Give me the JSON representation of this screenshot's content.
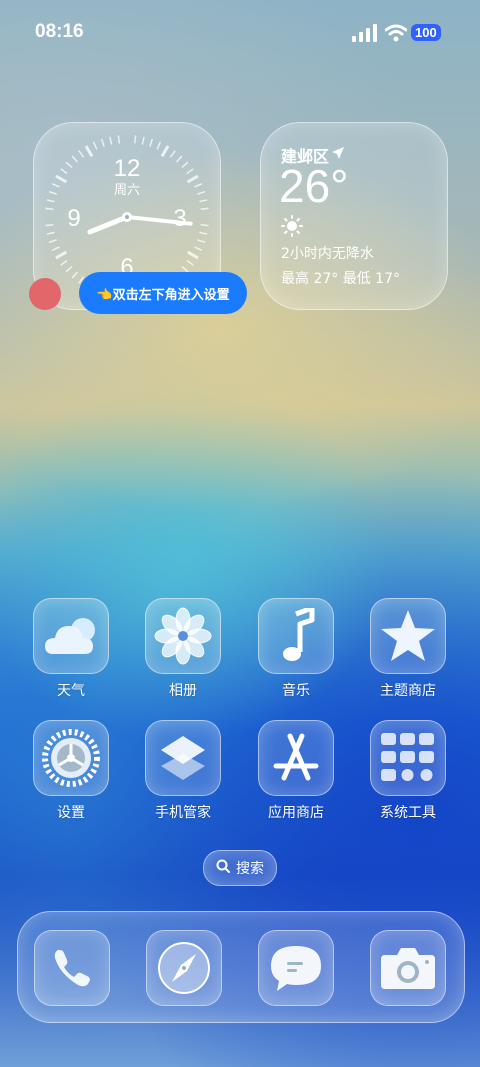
{
  "status_bar": {
    "time": "08:16",
    "battery": "100",
    "icons": [
      "signal-icon",
      "wifi-icon",
      "battery-icon"
    ]
  },
  "clock_widget": {
    "numerals": [
      "12",
      "3",
      "6",
      "9"
    ],
    "day": "周六",
    "shown_time": "08:16"
  },
  "weather_widget": {
    "city": "建邺区",
    "temperature": "26°",
    "condition_icon": "sun-icon",
    "description": "2小时内无降水",
    "range": "最高 27°  最低 17°"
  },
  "hint": {
    "text": "👈双击左下角进入设置"
  },
  "apps": [
    {
      "label": "天气",
      "icon": "cloud-icon"
    },
    {
      "label": "相册",
      "icon": "flower-icon"
    },
    {
      "label": "音乐",
      "icon": "music-note-icon"
    },
    {
      "label": "主题商店",
      "icon": "star-icon"
    },
    {
      "label": "设置",
      "icon": "gear-icon"
    },
    {
      "label": "手机管家",
      "icon": "layers-icon"
    },
    {
      "label": "应用商店",
      "icon": "appstore-icon"
    },
    {
      "label": "系统工具",
      "icon": "tools-folder-icon"
    }
  ],
  "search": {
    "label": "搜索",
    "icon": "search-icon"
  },
  "dock": [
    {
      "icon": "phone-icon"
    },
    {
      "icon": "compass-icon"
    },
    {
      "icon": "message-icon"
    },
    {
      "icon": "camera-icon"
    }
  ],
  "colors": {
    "accent": "#1a7bff",
    "battery_badge": "#2f62ff",
    "hint_dot": "#e1676b"
  }
}
